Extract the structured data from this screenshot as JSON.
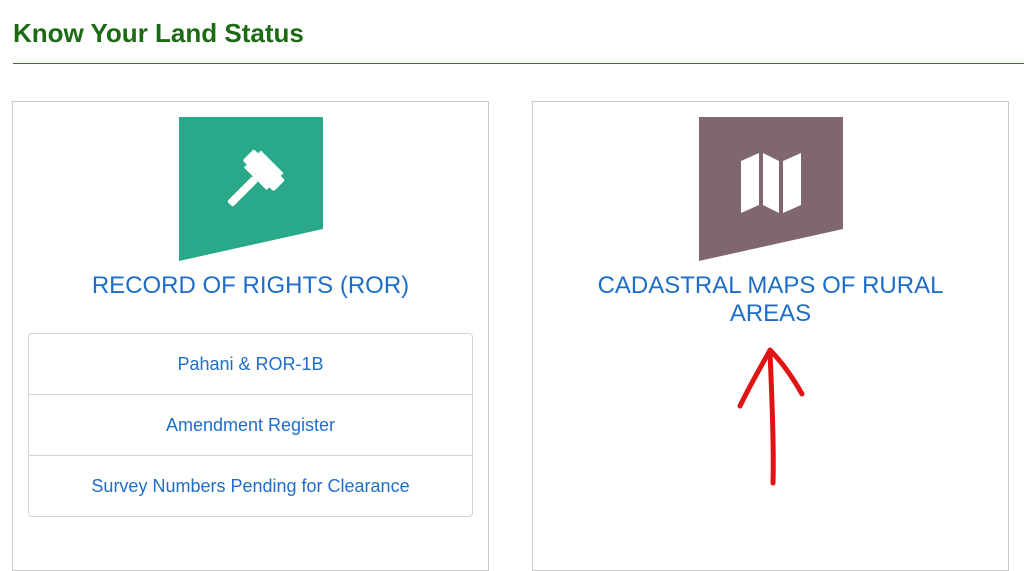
{
  "page": {
    "title": "Know Your Land Status"
  },
  "cards": [
    {
      "title": "RECORD OF RIGHTS (ROR)",
      "icon": "gavel-icon",
      "icon_bg": "#2aa98a",
      "links": [
        {
          "label": "Pahani & ROR-1B"
        },
        {
          "label": "Amendment Register"
        },
        {
          "label": "Survey Numbers Pending for Clearance"
        }
      ]
    },
    {
      "title": "CADASTRAL MAPS OF RURAL AREAS",
      "icon": "map-icon",
      "icon_bg": "#7f6670"
    }
  ],
  "colors": {
    "title_green": "#1a6b12",
    "link_blue": "#1e6ec8",
    "annotation_red": "#e01414"
  }
}
